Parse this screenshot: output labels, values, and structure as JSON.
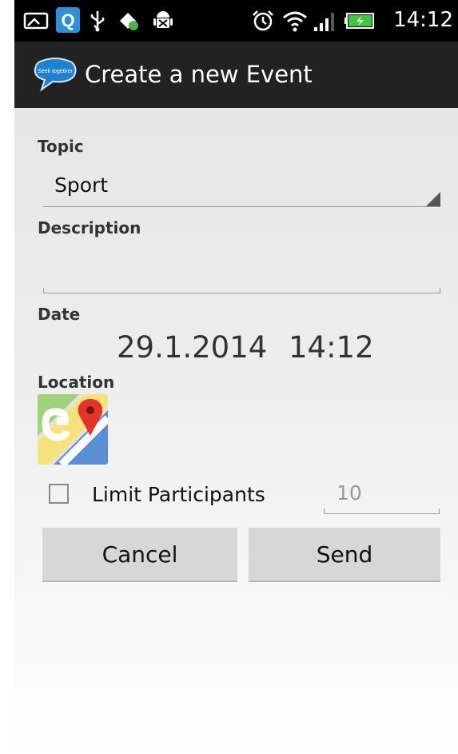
{
  "status_bar": {
    "time": "14:12",
    "icons": [
      "gallery-notification-icon",
      "q-app-icon",
      "usb-icon",
      "sync-icon",
      "android-debug-icon",
      "alarm-icon",
      "wifi-icon",
      "signal-icon",
      "battery-charging-icon"
    ]
  },
  "action_bar": {
    "title": "Create a new Event",
    "logo_icon": "speech-bubble-logo-icon",
    "logo_text": "Seek together"
  },
  "form": {
    "topic_label": "Topic",
    "topic_value": "Sport",
    "description_label": "Description",
    "description_value": "",
    "date_label": "Date",
    "date_value": "29.1.2014",
    "time_value": "14:12",
    "location_label": "Location",
    "location_icon": "google-maps-icon",
    "limit_label": "Limit Participants",
    "limit_checked": false,
    "limit_value": "10",
    "cancel_label": "Cancel",
    "send_label": "Send"
  },
  "colors": {
    "status_bar": "#000000",
    "action_bar": "#222222",
    "content_bg": "#e8e8e8",
    "button_bg": "#d7d7d7",
    "battery_green": "#3ec83e"
  }
}
